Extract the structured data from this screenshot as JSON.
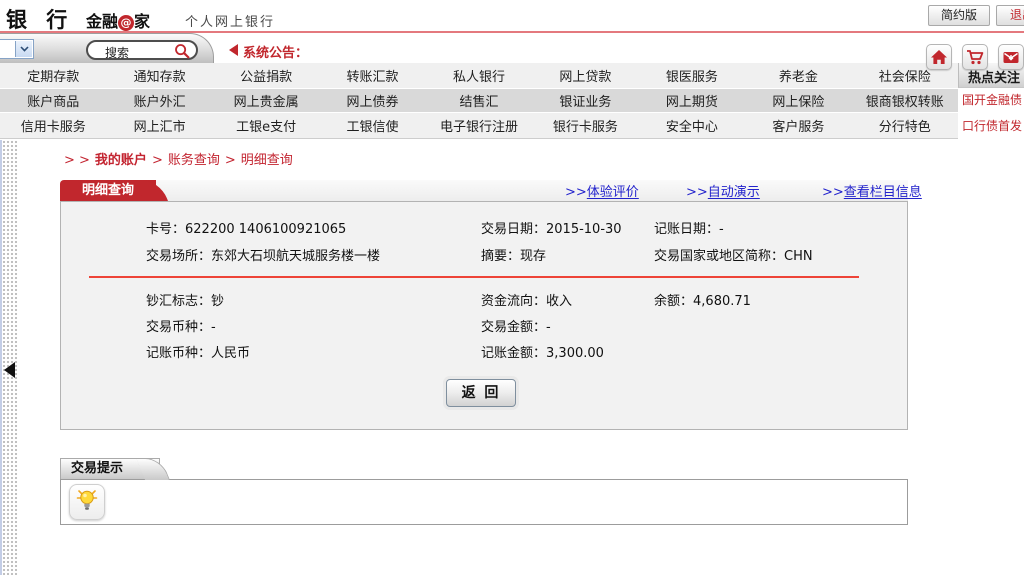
{
  "colors": {
    "accent_red": "#c1272d",
    "link_blue": "#2323cc",
    "breadcrumb_red": "#c32430"
  },
  "header": {
    "logo": "银 行",
    "brand_left": "金融",
    "brand_at": "@",
    "brand_right": "家",
    "subtitle": "个人网上银行",
    "simple_button": "简约版",
    "logout_button": "退出"
  },
  "toolbar": {
    "search_text": "搜索",
    "announcement": "系统公告："
  },
  "menu": {
    "rows": [
      [
        "定期存款",
        "通知存款",
        "公益捐款",
        "转账汇款",
        "私人银行",
        "网上贷款",
        "银医服务",
        "养老金",
        "社会保险"
      ],
      [
        "账户商品",
        "账户外汇",
        "网上贵金属",
        "网上债券",
        "结售汇",
        "银证业务",
        "网上期货",
        "网上保险",
        "银商银权转账"
      ],
      [
        "信用卡服务",
        "网上汇市",
        "工银e支付",
        "工银信使",
        "电子银行注册",
        "银行卡服务",
        "安全中心",
        "客户服务",
        "分行特色"
      ]
    ]
  },
  "hot": {
    "title": "热点关注",
    "items": [
      "国开金融债",
      "口行债首发"
    ]
  },
  "breadcrumb": {
    "arrows": "> >",
    "sep": ">",
    "items": [
      "我的账户",
      "账务查询",
      "明细查询"
    ]
  },
  "content": {
    "tab_title": "明细查询",
    "link_prefix": ">>",
    "links": [
      "体验评价",
      "自动演示",
      "查看栏目信息"
    ]
  },
  "detail": {
    "top_rows": [
      [
        {
          "label": "卡号：",
          "value": "622200 1406100921065"
        },
        {
          "label": "交易日期：",
          "value": "2015-10-30"
        },
        {
          "label": "记账日期：",
          "value": "-"
        }
      ],
      [
        {
          "label": "交易场所：",
          "value": "东郊大石坝航天城服务楼一楼"
        },
        {
          "label": "摘要：",
          "value": "现存"
        },
        {
          "label": "交易国家或地区简称：",
          "value": "CHN"
        }
      ]
    ],
    "bottom_rows": [
      [
        {
          "label": "钞汇标志：",
          "value": "钞"
        },
        {
          "label": "资金流向：",
          "value": "收入"
        },
        {
          "label": "余额：",
          "value": "4,680.71"
        }
      ],
      [
        {
          "label": "交易币种：",
          "value": "-"
        },
        {
          "label": "交易金额：",
          "value": "-"
        }
      ],
      [
        {
          "label": "记账币种：",
          "value": "人民币"
        },
        {
          "label": "记账金额：",
          "value": "3,300.00"
        }
      ]
    ],
    "back_button": "返 回"
  },
  "tips": {
    "title": "交易提示"
  }
}
